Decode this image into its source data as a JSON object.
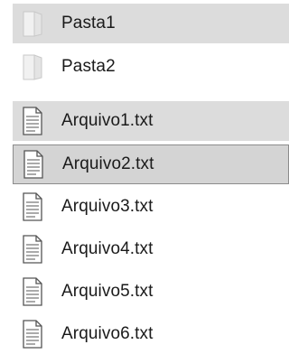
{
  "explorer": {
    "items": [
      {
        "name": "Pasta1",
        "icon": "folder-icon",
        "state": "selected"
      },
      {
        "name": "Pasta2",
        "icon": "folder-icon",
        "state": "normal"
      },
      {
        "name": "Arquivo1.txt",
        "icon": "text-file-icon",
        "state": "selected"
      },
      {
        "name": "Arquivo2.txt",
        "icon": "text-file-icon",
        "state": "focused"
      },
      {
        "name": "Arquivo3.txt",
        "icon": "text-file-icon",
        "state": "normal"
      },
      {
        "name": "Arquivo4.txt",
        "icon": "text-file-icon",
        "state": "normal"
      },
      {
        "name": "Arquivo5.txt",
        "icon": "text-file-icon",
        "state": "normal"
      },
      {
        "name": "Arquivo6.txt",
        "icon": "text-file-icon",
        "state": "normal"
      }
    ]
  },
  "colors": {
    "selection": "#dcdcdc",
    "focus_border": "#8c8c8c"
  }
}
